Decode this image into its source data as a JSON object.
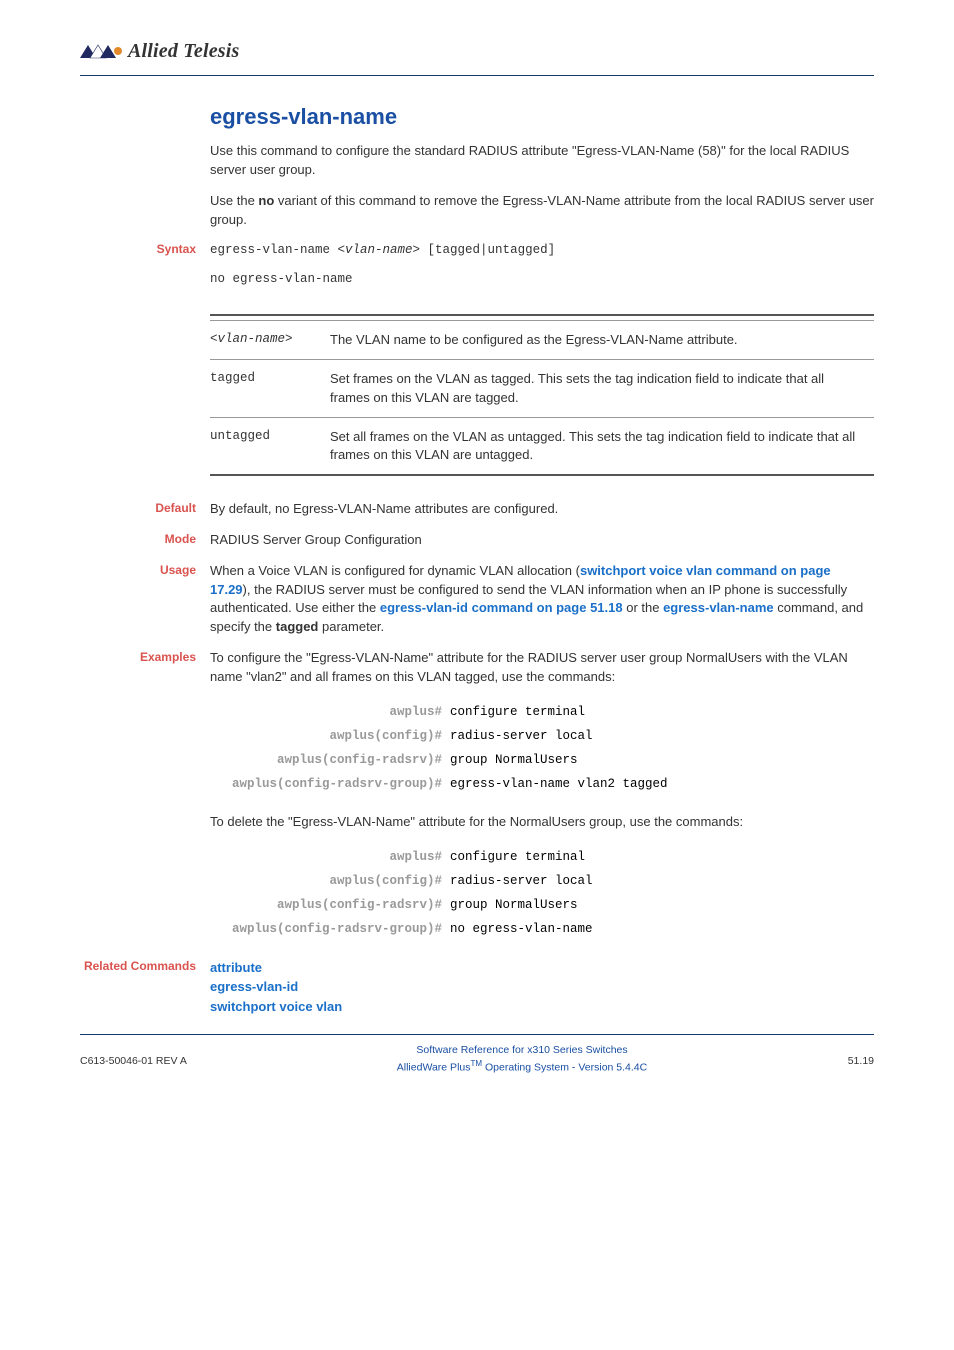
{
  "brand": "Allied Telesis",
  "title": "egress-vlan-name",
  "intro1": "Use this command to configure the standard RADIUS attribute \"Egress-VLAN-Name (58)\" for the local RADIUS server user group.",
  "intro2_pre": "Use the ",
  "intro2_bold": "no",
  "intro2_post": " variant of this command to remove the Egress-VLAN-Name attribute from the local RADIUS server user group.",
  "labels": {
    "syntax": "Syntax",
    "default": "Default",
    "mode": "Mode",
    "usage": "Usage",
    "examples": "Examples",
    "related": "Related Commands"
  },
  "syntax": {
    "line1_a": "egress-vlan-name <",
    "line1_b": "vlan-name",
    "line1_c": "> [tagged|untagged]",
    "line2": "no egress-vlan-name"
  },
  "params": [
    {
      "name_a": "<",
      "name_b": "vlan-name",
      "name_c": ">",
      "desc": "The VLAN name to be configured as the Egress-VLAN-Name attribute."
    },
    {
      "name": "tagged",
      "desc": "Set frames on the VLAN as tagged. This sets the tag indication field to indicate that all frames on this VLAN are tagged."
    },
    {
      "name": "untagged",
      "desc": "Set all frames on the VLAN as untagged. This sets the tag indication field to indicate that all frames on this VLAN are untagged."
    }
  ],
  "default_text": "By default, no Egress-VLAN-Name attributes are configured.",
  "mode_text": "RADIUS Server Group Configuration",
  "usage": {
    "t1": "When a Voice VLAN is configured for dynamic VLAN allocation (",
    "l1": "switchport voice vlan",
    "t2": " command on page 17.29",
    "t3": "), the RADIUS server must be configured to send the VLAN information when an IP phone is successfully authenticated. Use either the ",
    "l2": "egress-vlan-id",
    "t4": " command on page 51.18",
    "t5": " or the ",
    "l3": "egress-vlan-name",
    "t6": " command, and specify the ",
    "b1": "tagged",
    "t7": " parameter."
  },
  "example1_text": "To configure the \"Egress-VLAN-Name\" attribute for the RADIUS server user group NormalUsers with the VLAN name \"vlan2\" and all frames on this VLAN tagged, use the commands:",
  "cli1": [
    {
      "prompt": "awplus#",
      "cmd": "configure terminal"
    },
    {
      "prompt": "awplus(config)#",
      "cmd": "radius-server local"
    },
    {
      "prompt": "awplus(config-radsrv)#",
      "cmd": "group NormalUsers"
    },
    {
      "prompt": "awplus(config-radsrv-group)#",
      "cmd": "egress-vlan-name vlan2 tagged"
    }
  ],
  "example2_text": "To delete the \"Egress-VLAN-Name\" attribute for the NormalUsers group, use the commands:",
  "cli2": [
    {
      "prompt": "awplus#",
      "cmd": "configure terminal"
    },
    {
      "prompt": "awplus(config)#",
      "cmd": "radius-server local"
    },
    {
      "prompt": "awplus(config-radsrv)#",
      "cmd": "group NormalUsers"
    },
    {
      "prompt": "awplus(config-radsrv-group)#",
      "cmd": "no egress-vlan-name"
    }
  ],
  "related": [
    "attribute",
    "egress-vlan-id",
    "switchport voice vlan"
  ],
  "footer": {
    "left": "C613-50046-01 REV A",
    "center1": "Software Reference for x310 Series Switches",
    "center2a": "AlliedWare Plus",
    "center2b": "TM",
    "center2c": " Operating System - Version 5.4.4C",
    "right": "51.19"
  }
}
